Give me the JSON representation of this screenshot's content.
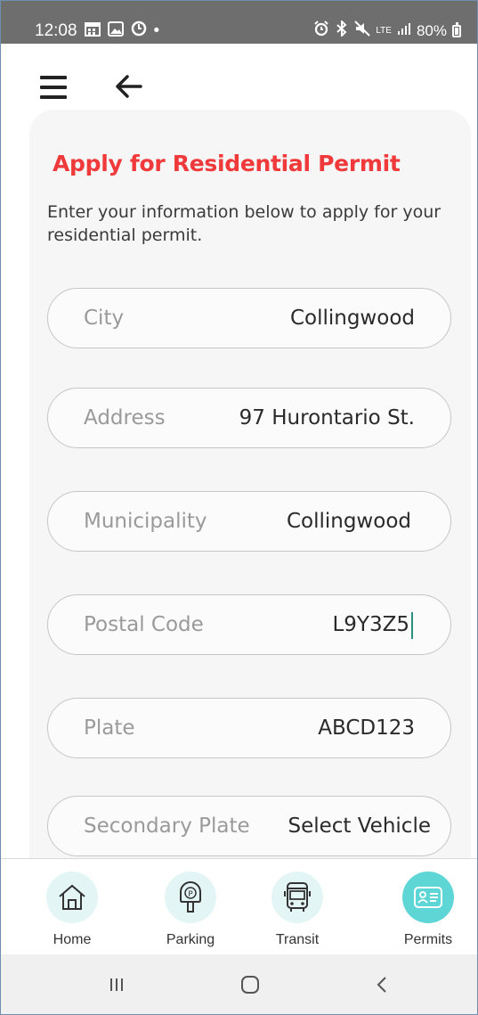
{
  "status_bar": {
    "time": "12:08",
    "dot": "•",
    "battery_percent": "80%",
    "left_icons": [
      "calendar-icon",
      "gallery-icon",
      "sync-icon"
    ],
    "right_icons": [
      "alarm-icon",
      "bluetooth-icon",
      "mute-icon",
      "lte-icon",
      "signal-icon",
      "battery-icon"
    ],
    "lte": "LTE"
  },
  "app_bar": {
    "menu_icon": "hamburger-menu-icon",
    "back_icon": "back-arrow-icon"
  },
  "form": {
    "title": "Apply for Residential Permit",
    "subtitle": "Enter your information below to apply for your residential permit.",
    "fields": [
      {
        "label": "City",
        "value": "Collingwood"
      },
      {
        "label": "Address",
        "value": "97 Hurontario St."
      },
      {
        "label": "Municipality",
        "value": "Collingwood"
      },
      {
        "label": "Postal Code",
        "value": "L9Y3Z5"
      },
      {
        "label": "Plate",
        "value": "ABCD123"
      },
      {
        "label": "Secondary Plate",
        "value": "Select Vehicle"
      }
    ]
  },
  "bottom_nav": {
    "items": [
      {
        "label": "Home",
        "icon": "home-icon",
        "active": false
      },
      {
        "label": "Parking",
        "icon": "parking-meter-icon",
        "active": false
      },
      {
        "label": "Transit",
        "icon": "bus-icon",
        "active": false
      },
      {
        "label": "Permits",
        "icon": "permit-card-icon",
        "active": true
      }
    ],
    "accent_color": "#5ed6d6",
    "inactive_bg": "#e3f5f5"
  },
  "system_nav": {
    "buttons": [
      "recents-icon",
      "home-button-icon",
      "back-icon"
    ]
  },
  "colors": {
    "title": "#f0393a",
    "status_bar": "#6e6e6e",
    "caret": "#2a8f80"
  }
}
